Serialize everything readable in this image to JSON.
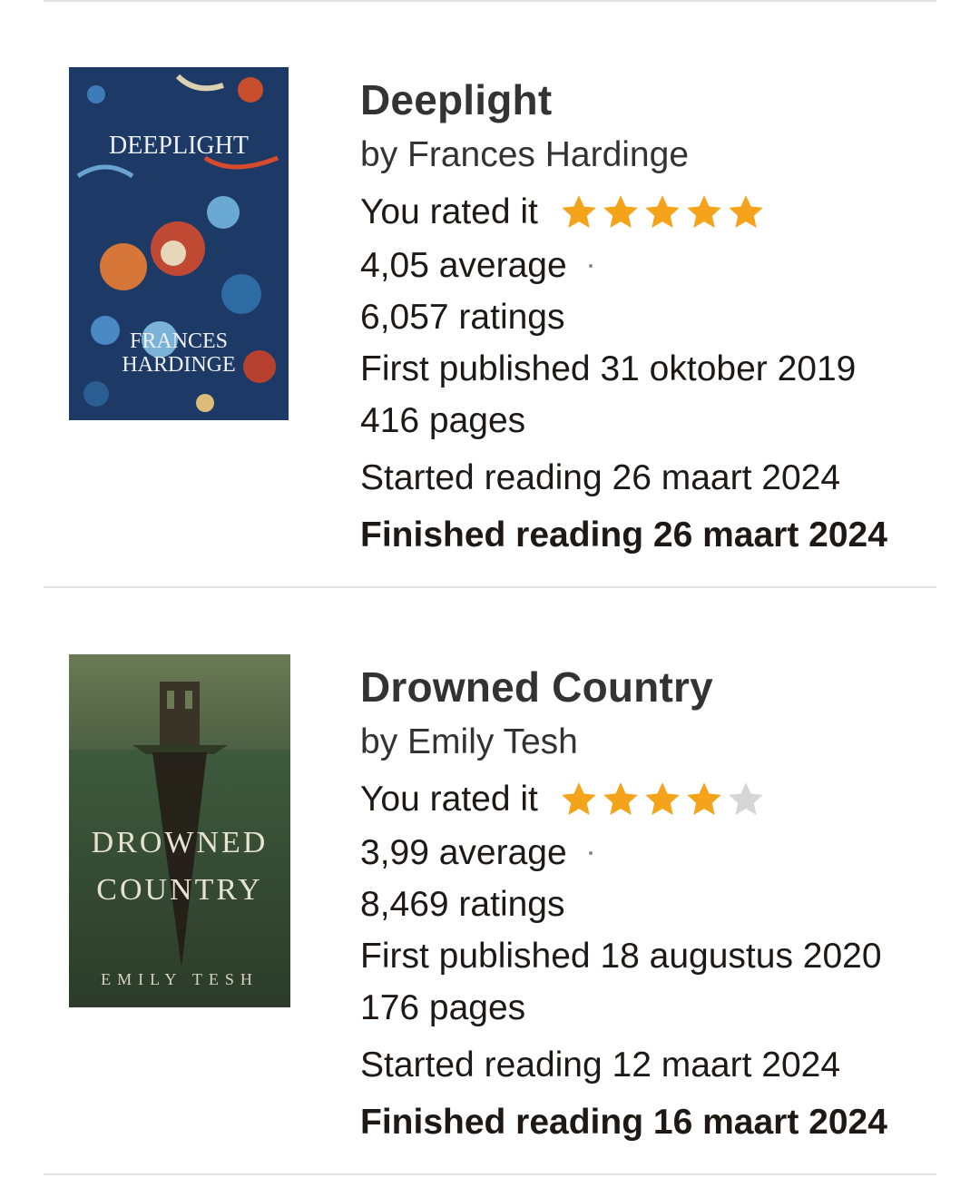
{
  "books": [
    {
      "title": "Deeplight",
      "author": "by Frances Hardinge",
      "rating_label": "You rated it",
      "user_rating": 5,
      "max_rating": 5,
      "average": "4,05 average",
      "ratings_count": "6,057 ratings",
      "first_published": "First published 31 oktober 2019",
      "pages": "416 pages",
      "started": "Started reading 26 maart 2024",
      "finished": "Finished reading 26 maart 2024",
      "cover": {
        "title": "DEEPLIGHT",
        "author_line1": "FRANCES",
        "author_line2": "HARDINGE",
        "bg_color": "#1d3a66"
      }
    },
    {
      "title": "Drowned Country",
      "author": "by Emily Tesh",
      "rating_label": "You rated it",
      "user_rating": 4,
      "max_rating": 5,
      "average": "3,99 average",
      "ratings_count": "8,469 ratings",
      "first_published": "First published 18 augustus 2020",
      "pages": "176 pages",
      "started": "Started reading 12 maart 2024",
      "finished": "Finished reading 16 maart 2024",
      "cover": {
        "title_line1": "DROWNED",
        "title_line2": "COUNTRY",
        "author": "EMILY TESH",
        "bg_color": "#3f4d36"
      }
    }
  ],
  "colors": {
    "star_filled": "#f4a31b",
    "star_empty": "#d6d6d6",
    "divider": "#e4e2df"
  }
}
